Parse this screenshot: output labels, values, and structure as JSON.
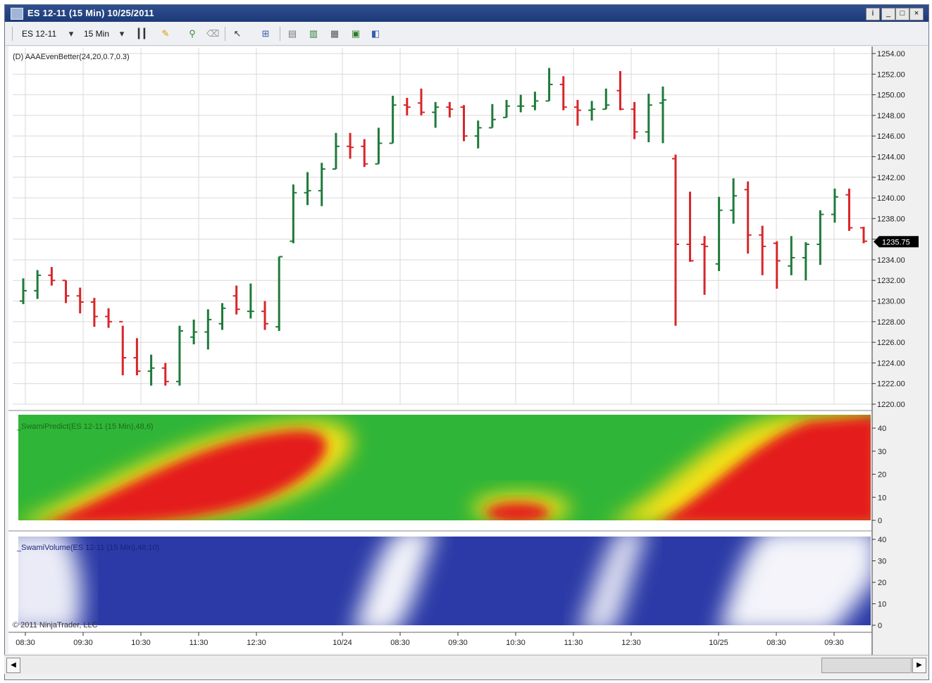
{
  "window": {
    "title": "ES 12-11 (15 Min) 10/25/2011",
    "controls": [
      "i",
      "_",
      "□",
      "×"
    ]
  },
  "toolbar": {
    "instrument": "ES 12-11",
    "interval": "15 Min"
  },
  "copyright": "© 2011 NinjaTrader, LLC",
  "colors": {
    "up": "#1f7a3a",
    "down": "#d7262b",
    "grid": "#d9d9d9",
    "last_price_bg": "#000000"
  },
  "chart_data": [
    {
      "type": "ohlc",
      "title": "(D) AAAEvenBetter(24,20,0.7,0.3)",
      "ylim": [
        1220,
        1254
      ],
      "y_ticks": [
        "1220.00",
        "1222.00",
        "1224.00",
        "1226.00",
        "1228.00",
        "1230.00",
        "1232.00",
        "1234.00",
        "1236.00",
        "1238.00",
        "1240.00",
        "1242.00",
        "1244.00",
        "1246.00",
        "1248.00",
        "1250.00",
        "1252.00",
        "1254.00"
      ],
      "last_price": "1235.75",
      "x_tick_labels": [
        "08:30",
        "09:30",
        "10:30",
        "11:30",
        "12:30",
        "10/24",
        "08:30",
        "09:30",
        "10:30",
        "11:30",
        "12:30",
        "10/25",
        "08:30",
        "09:30"
      ],
      "bars": [
        [
          1230.0,
          1232.2,
          1229.7,
          1231.0
        ],
        [
          1231.0,
          1233.0,
          1230.2,
          1232.5
        ],
        [
          1232.5,
          1233.3,
          1231.5,
          1232.0
        ],
        [
          1232.0,
          1232.0,
          1229.8,
          1230.5
        ],
        [
          1230.5,
          1231.3,
          1228.8,
          1229.9
        ],
        [
          1229.9,
          1230.3,
          1227.5,
          1228.5
        ],
        [
          1228.5,
          1229.3,
          1227.4,
          1228.0
        ],
        [
          1228.0,
          1227.6,
          1222.8,
          1224.5
        ],
        [
          1224.5,
          1226.4,
          1222.8,
          1223.2
        ],
        [
          1223.2,
          1224.8,
          1221.8,
          1223.5
        ],
        [
          1223.5,
          1224.0,
          1221.8,
          1222.2
        ],
        [
          1222.2,
          1227.6,
          1221.8,
          1227.1
        ],
        [
          1226.5,
          1228.2,
          1225.8,
          1227.0
        ],
        [
          1227.0,
          1229.2,
          1225.3,
          1228.2
        ],
        [
          1227.8,
          1229.8,
          1227.2,
          1229.3
        ],
        [
          1230.5,
          1231.5,
          1228.7,
          1229.2
        ],
        [
          1229.0,
          1231.7,
          1228.3,
          1229.0
        ],
        [
          1229.0,
          1230.0,
          1227.2,
          1227.8
        ],
        [
          1227.5,
          1234.3,
          1227.1,
          1234.3
        ],
        [
          1235.8,
          1241.3,
          1235.6,
          1240.5
        ],
        [
          1240.5,
          1242.5,
          1239.3,
          1240.7
        ],
        [
          1240.7,
          1243.4,
          1239.2,
          1242.8
        ],
        [
          1242.8,
          1246.3,
          1242.8,
          1245.0
        ],
        [
          1245.0,
          1246.3,
          1243.8,
          1244.9
        ],
        [
          1245.0,
          1245.7,
          1243.0,
          1243.3
        ],
        [
          1243.3,
          1246.8,
          1243.3,
          1245.3
        ],
        [
          1245.3,
          1249.9,
          1245.3,
          1249.0
        ],
        [
          1249.0,
          1249.7,
          1248.0,
          1248.8
        ],
        [
          1249.2,
          1250.6,
          1248.0,
          1248.3
        ],
        [
          1248.3,
          1249.3,
          1246.8,
          1248.8
        ],
        [
          1248.8,
          1249.3,
          1247.8,
          1248.6
        ],
        [
          1248.8,
          1249.0,
          1245.5,
          1246.0
        ],
        [
          1246.0,
          1247.5,
          1244.8,
          1246.8
        ],
        [
          1246.8,
          1249.1,
          1246.8,
          1247.6
        ],
        [
          1247.8,
          1249.5,
          1247.8,
          1248.9
        ],
        [
          1248.9,
          1250.0,
          1248.3,
          1248.9
        ],
        [
          1248.9,
          1250.3,
          1248.5,
          1249.4
        ],
        [
          1249.4,
          1252.6,
          1249.4,
          1251.0
        ],
        [
          1251.0,
          1251.8,
          1248.5,
          1248.8
        ],
        [
          1248.8,
          1249.5,
          1247.0,
          1248.5
        ],
        [
          1248.5,
          1249.4,
          1247.5,
          1248.6
        ],
        [
          1248.6,
          1250.6,
          1248.6,
          1249.0
        ],
        [
          1250.4,
          1252.3,
          1248.5,
          1248.6
        ],
        [
          1248.6,
          1249.3,
          1245.7,
          1246.4
        ],
        [
          1246.4,
          1250.1,
          1245.4,
          1249.0
        ],
        [
          1249.2,
          1250.8,
          1245.3,
          1249.5
        ],
        [
          1243.8,
          1244.2,
          1227.6,
          1235.5
        ],
        [
          1235.5,
          1240.6,
          1233.8,
          1233.9
        ],
        [
          1235.5,
          1236.3,
          1230.6,
          1235.3
        ],
        [
          1233.6,
          1240.1,
          1232.9,
          1238.8
        ],
        [
          1238.8,
          1241.9,
          1237.5,
          1240.2
        ],
        [
          1240.8,
          1241.6,
          1234.6,
          1236.4
        ],
        [
          1236.4,
          1237.3,
          1232.5,
          1235.3
        ],
        [
          1235.6,
          1235.8,
          1231.2,
          1233.9
        ],
        [
          1233.4,
          1236.3,
          1232.5,
          1234.2
        ],
        [
          1234.2,
          1235.7,
          1232.0,
          1235.5
        ],
        [
          1235.5,
          1238.8,
          1233.5,
          1238.4
        ],
        [
          1238.4,
          1240.9,
          1237.6,
          1240.1
        ],
        [
          1240.3,
          1240.9,
          1236.8,
          1237.1
        ],
        [
          1237.1,
          1237.2,
          1235.6,
          1235.8
        ]
      ]
    },
    {
      "type": "heatmap",
      "title": "_SwamiPredict(ES 12-11 (15 Min),48,6)",
      "ylim": [
        0,
        40
      ],
      "y_ticks": [
        "0",
        "10",
        "20",
        "30",
        "40"
      ],
      "palette": [
        "#2fb538",
        "#f2e014",
        "#e41e1e"
      ]
    },
    {
      "type": "heatmap",
      "title": "_SwamiVolume(ES 12-11 (15 Min),48,10)",
      "ylim": [
        0,
        40
      ],
      "y_ticks": [
        "0",
        "10",
        "20",
        "30",
        "40"
      ],
      "palette": [
        "#2b3aa6",
        "#ffffff"
      ]
    }
  ]
}
